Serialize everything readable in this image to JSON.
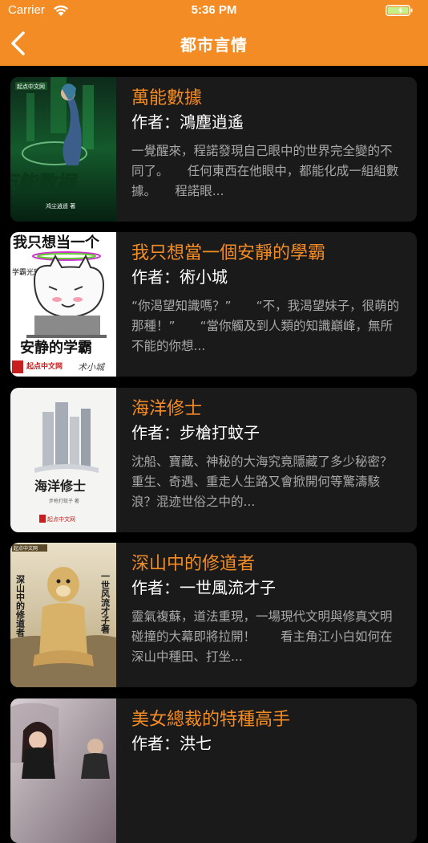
{
  "status_bar": {
    "carrier": "Carrier",
    "time": "5:36 PM",
    "wifi_icon": "wifi-icon",
    "battery_icon": "battery-icon"
  },
  "nav": {
    "title": "都市言情",
    "back_icon": "chevron-left-icon",
    "background_color": "#f48c25"
  },
  "books": [
    {
      "title": "萬能數據",
      "author": "作者：鴻塵逍遙",
      "description": "一覺醒來，程諾發現自己眼中的世界完全變的不同了。　　任何東西在他眼中，都能化成一組組數據。　　程諾眼...",
      "cover": {
        "publisher": "起点中文网",
        "title_art": "万能数据",
        "author_line": "鸿尘逍遥 著"
      }
    },
    {
      "title": "我只想當一個安靜的學霸",
      "author": "作者：術小城",
      "description": "“你渴望知識嗎？”　　“不，我渴望妹子，很萌的那種！”　　“當你觸及到人類的知識巔峰，無所不能的你想...",
      "cover": {
        "top_text": "我只想当一个",
        "halo_label": "学霸光环",
        "bottom_text": "安静的学霸",
        "publisher": "起点中文网",
        "signature": "术小城"
      }
    },
    {
      "title": "海洋修士",
      "author": "作者：步槍打蚊子",
      "description": "沈船、寶藏、神秘的大海究竟隱藏了多少秘密？重生、奇遇、重走人生路又會掀開何等驚濤駭浪？混迹世俗之中的...",
      "cover": {
        "title_art": "海洋修士",
        "author_line": "步枪打蚊子 著",
        "publisher": "起点中文网"
      }
    },
    {
      "title": "深山中的修道者",
      "author": "作者：一世風流才子",
      "description": "靈氣複蘇，道法重現，一場現代文明與修真文明碰撞的大幕即將拉開！　　看主角江小白如何在深山中種田、打坐...",
      "cover": {
        "publisher": "起点中文网",
        "left_text": "深山中的修道者",
        "right_text": "一世风流才子著"
      }
    },
    {
      "title": "美女總裁的特種高手",
      "author": "作者：洪七",
      "description": "",
      "cover": {}
    }
  ],
  "colors": {
    "accent": "#f48c25",
    "card_bg": "#1a1a1a",
    "page_bg": "#000000",
    "author_text": "#ffffff",
    "desc_text": "#a8a8a8"
  }
}
